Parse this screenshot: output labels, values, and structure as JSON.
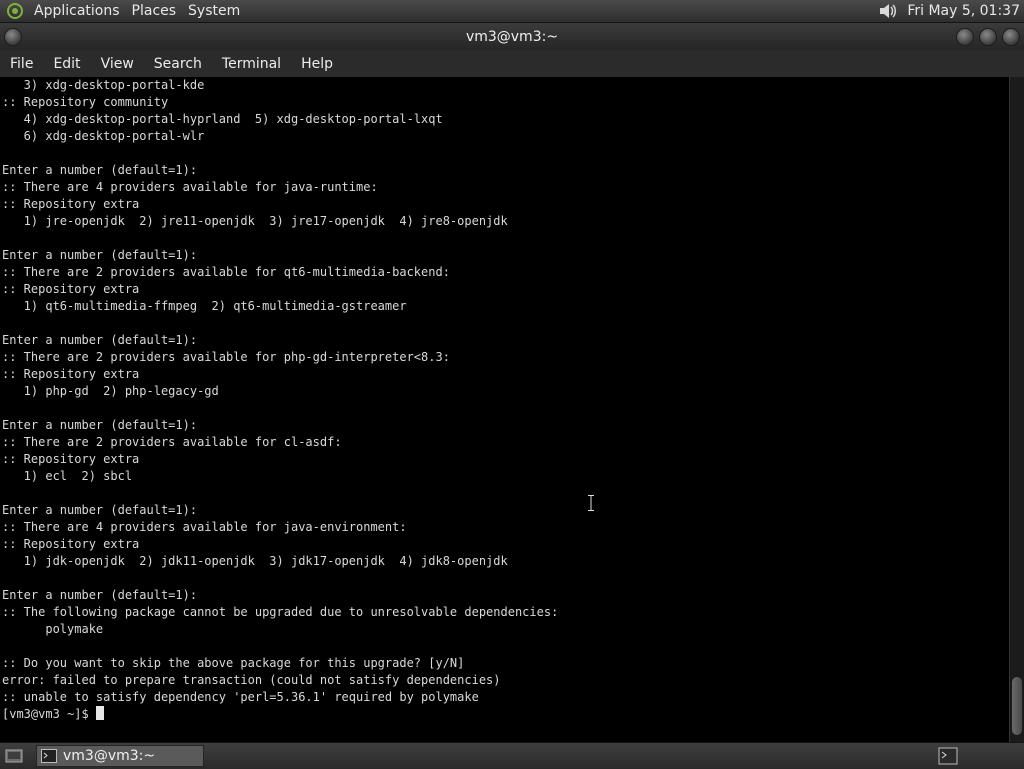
{
  "top_panel": {
    "menus": [
      "Applications",
      "Places",
      "System"
    ],
    "clock": "Fri May  5, 01:37"
  },
  "window": {
    "title": "vm3@vm3:~"
  },
  "menubar": {
    "items": [
      "File",
      "Edit",
      "View",
      "Search",
      "Terminal",
      "Help"
    ]
  },
  "terminal": {
    "lines": [
      "   3) xdg-desktop-portal-kde",
      ":: Repository community",
      "   4) xdg-desktop-portal-hyprland  5) xdg-desktop-portal-lxqt",
      "   6) xdg-desktop-portal-wlr",
      "",
      "Enter a number (default=1):",
      ":: There are 4 providers available for java-runtime:",
      ":: Repository extra",
      "   1) jre-openjdk  2) jre11-openjdk  3) jre17-openjdk  4) jre8-openjdk",
      "",
      "Enter a number (default=1):",
      ":: There are 2 providers available for qt6-multimedia-backend:",
      ":: Repository extra",
      "   1) qt6-multimedia-ffmpeg  2) qt6-multimedia-gstreamer",
      "",
      "Enter a number (default=1):",
      ":: There are 2 providers available for php-gd-interpreter<8.3:",
      ":: Repository extra",
      "   1) php-gd  2) php-legacy-gd",
      "",
      "Enter a number (default=1):",
      ":: There are 2 providers available for cl-asdf:",
      ":: Repository extra",
      "   1) ecl  2) sbcl",
      "",
      "Enter a number (default=1):",
      ":: There are 4 providers available for java-environment:",
      ":: Repository extra",
      "   1) jdk-openjdk  2) jdk11-openjdk  3) jdk17-openjdk  4) jdk8-openjdk",
      "",
      "Enter a number (default=1):",
      ":: The following package cannot be upgraded due to unresolvable dependencies:",
      "      polymake",
      "",
      ":: Do you want to skip the above package for this upgrade? [y/N]",
      "error: failed to prepare transaction (could not satisfy dependencies)",
      ":: unable to satisfy dependency 'perl=5.36.1' required by polymake"
    ],
    "prompt": "[vm3@vm3 ~]$ "
  },
  "taskbar": {
    "task_label": "vm3@vm3:~"
  },
  "colors": {
    "terminal_bg": "#000000",
    "terminal_fg": "#d9d9d9",
    "panel_bg": "#3a3a3a"
  },
  "icons": [
    "gnome-foot-icon",
    "volume-icon",
    "show-desktop-icon",
    "terminal-icon"
  ]
}
